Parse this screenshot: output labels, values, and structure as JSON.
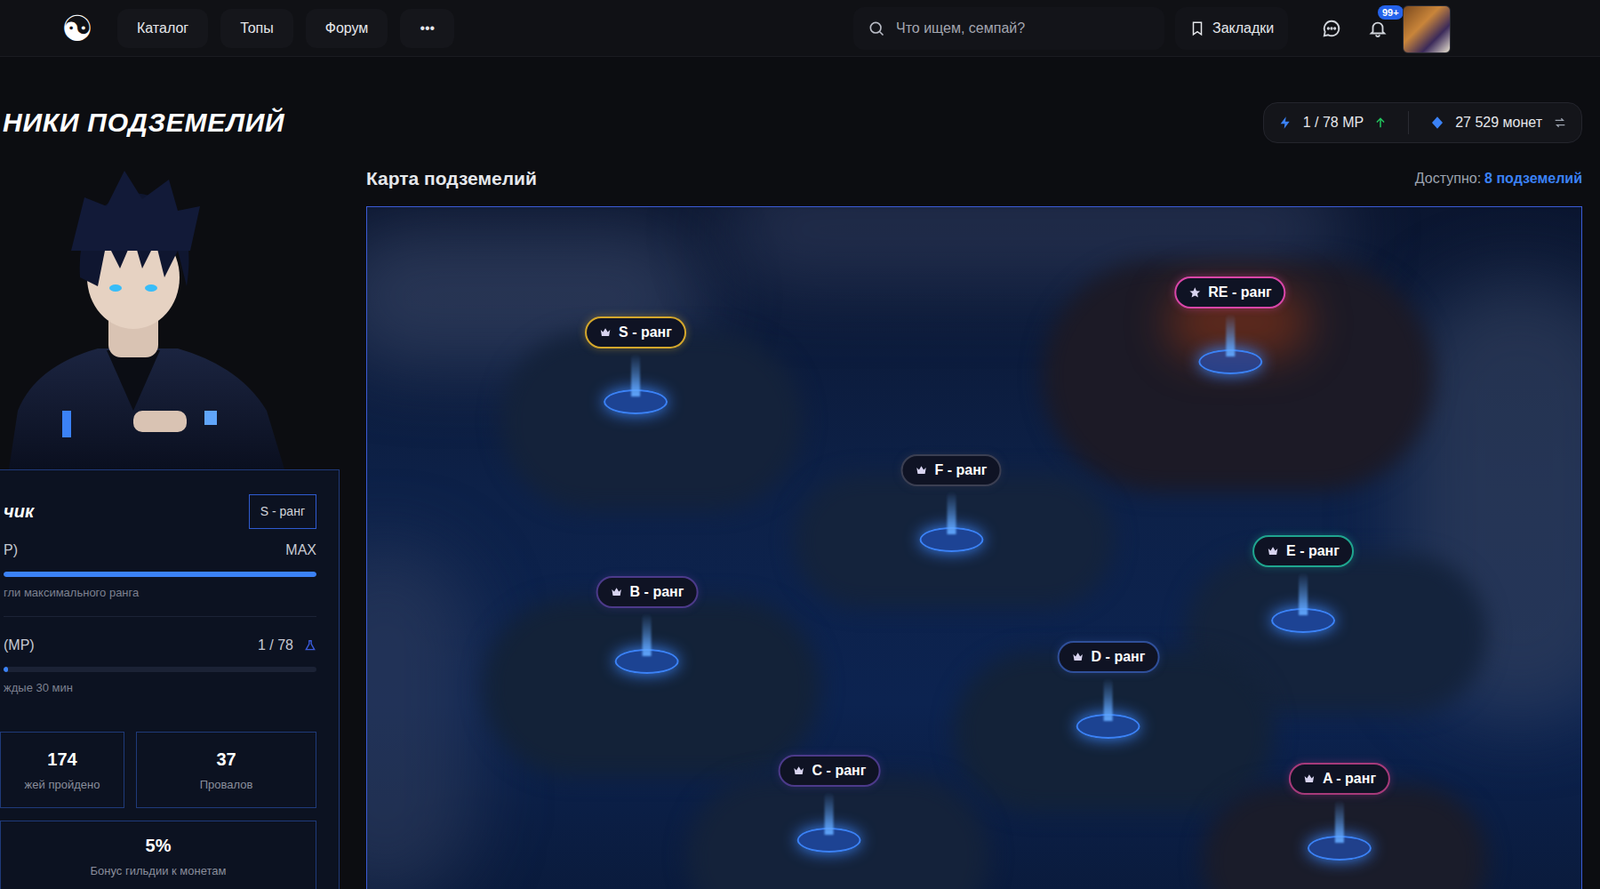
{
  "nav": {
    "logo": "☯",
    "items": [
      "Каталог",
      "Топы",
      "Форум",
      "•••"
    ],
    "search_placeholder": "Что ищем, семпай?",
    "bookmarks": "Закладки",
    "notifications_badge": "99+"
  },
  "header": {
    "title": "НИКИ ПОДЗЕМЕЛИЙ",
    "mp": "1 / 78 MP",
    "coins": "27 529 монет"
  },
  "profile": {
    "title": "чик",
    "rank": "S - ранг",
    "xp_label": "P)",
    "xp_value": "MAX",
    "xp_level": 1,
    "xp_note": "гли максимального ранга",
    "mp_label": "(MP)",
    "mp_value": "1 / 78",
    "mp_level": 0.013,
    "mp_note": "ждые 30 мин",
    "stats": [
      {
        "value": "174",
        "label": "жей пройдено"
      },
      {
        "value": "37",
        "label": "Провалов"
      }
    ],
    "bonus": {
      "value": "5%",
      "label": "Бонус гильдии к монетам"
    }
  },
  "map": {
    "title": "Карта подземелий",
    "available_label": "Доступно:",
    "available_value": "8 подземелий",
    "dungeons": [
      {
        "label": "S - ранг",
        "kind": "crown",
        "color": "#d4a72c"
      },
      {
        "label": "RE - ранг",
        "kind": "star",
        "color": "#d946a8"
      },
      {
        "label": "F - ранг",
        "kind": "crown",
        "color": "#3b3f52"
      },
      {
        "label": "B - ранг",
        "kind": "crown",
        "color": "#4c3a8a"
      },
      {
        "label": "E - ранг",
        "kind": "crown",
        "color": "#1fa58f"
      },
      {
        "label": "D - ранг",
        "kind": "crown",
        "color": "#2f4f9a"
      },
      {
        "label": "C - ранг",
        "kind": "crown",
        "color": "#4c3a8a"
      },
      {
        "label": "A - ранг",
        "kind": "crown",
        "color": "#a63a7a"
      }
    ]
  }
}
